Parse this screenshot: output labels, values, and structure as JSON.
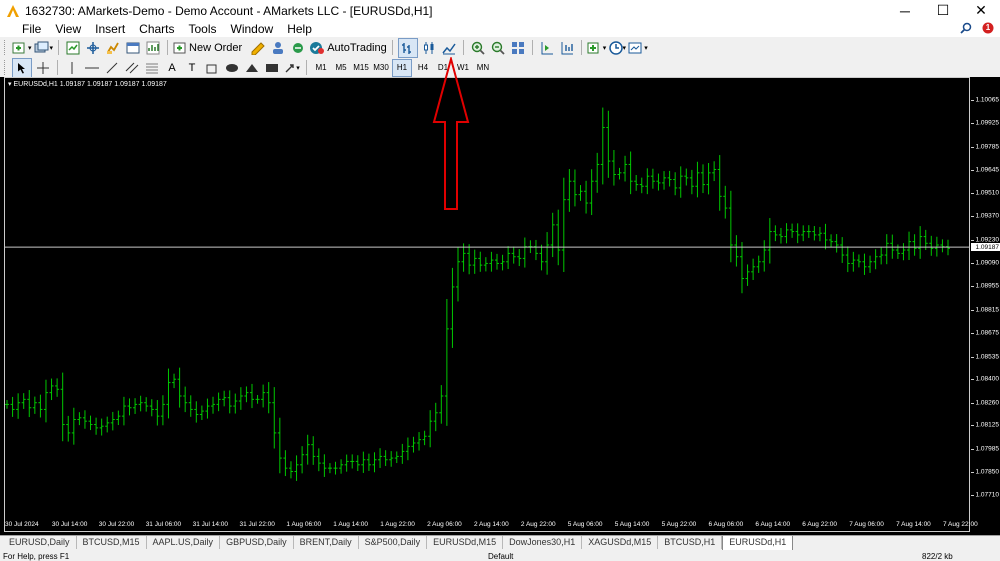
{
  "window": {
    "title": "1632730: AMarkets-Demo - Demo Account - AMarkets LLC - [EURUSDd,H1]",
    "controls": {
      "minimize": "─",
      "maximize": "☐",
      "close": "✕"
    }
  },
  "menu": {
    "items": [
      {
        "label": "File"
      },
      {
        "label": "View"
      },
      {
        "label": "Insert"
      },
      {
        "label": "Charts"
      },
      {
        "label": "Tools"
      },
      {
        "label": "Window"
      },
      {
        "label": "Help"
      }
    ],
    "notification_count": "1"
  },
  "toolbar": {
    "new_order_label": "New Order",
    "autotrading_label": "AutoTrading",
    "timeframes": [
      "M1",
      "M5",
      "M15",
      "M30",
      "H1",
      "H4",
      "D1",
      "W1",
      "MN"
    ],
    "active_timeframe": "H1"
  },
  "chart": {
    "info_line": "EURUSDd,H1  1.09187 1.09187 1.09187 1.09187",
    "current_price": "1.09187",
    "background": "#000000",
    "bar_color": "#00c800",
    "annotation_arrow_color": "#e00000"
  },
  "chart_data": {
    "type": "ohlc",
    "symbol": "EURUSDd",
    "timeframe": "H1",
    "ylim": [
      1.0771,
      1.1007
    ],
    "y_ticks": [
      "1.10065",
      "1.09925",
      "1.09785",
      "1.09645",
      "1.09510",
      "1.09370",
      "1.09230",
      "1.09090",
      "1.08955",
      "1.08815",
      "1.08675",
      "1.08535",
      "1.08400",
      "1.08260",
      "1.08125",
      "1.07985",
      "1.07850",
      "1.07710"
    ],
    "x_ticks": [
      "30 Jul 2024",
      "30 Jul 14:00",
      "30 Jul 22:00",
      "31 Jul 06:00",
      "31 Jul 14:00",
      "31 Jul 22:00",
      "1 Aug 06:00",
      "1 Aug 14:00",
      "1 Aug 22:00",
      "2 Aug 06:00",
      "2 Aug 14:00",
      "2 Aug 22:00",
      "5 Aug 06:00",
      "5 Aug 14:00",
      "5 Aug 22:00",
      "6 Aug 06:00",
      "6 Aug 14:00",
      "6 Aug 22:00",
      "7 Aug 06:00",
      "7 Aug 14:00",
      "7 Aug 22:00"
    ],
    "current_price": 1.09187,
    "closes": [
      1.0825,
      1.0822,
      1.0826,
      1.0828,
      1.0823,
      1.0826,
      1.0822,
      1.0832,
      1.0836,
      1.0834,
      1.0813,
      1.0808,
      1.0816,
      1.0817,
      1.0815,
      1.0813,
      1.0811,
      1.0812,
      1.0814,
      1.0816,
      1.0818,
      1.0824,
      1.0823,
      1.0825,
      1.0826,
      1.0824,
      1.0822,
      1.0818,
      1.0825,
      1.0838,
      1.084,
      1.083,
      1.0826,
      1.0822,
      1.0819,
      1.0821,
      1.0824,
      1.0825,
      1.0828,
      1.0829,
      1.0824,
      1.0827,
      1.083,
      1.0832,
      1.0828,
      1.0828,
      1.0832,
      1.0826,
      1.0808,
      1.0793,
      1.0787,
      1.0785,
      1.0789,
      1.0795,
      1.0801,
      1.0794,
      1.079,
      1.0787,
      1.0787,
      1.0787,
      1.0789,
      1.0791,
      1.0791,
      1.0789,
      1.0792,
      1.0789,
      1.0792,
      1.0794,
      1.0792,
      1.0793,
      1.0794,
      1.0797,
      1.08,
      1.0802,
      1.0804,
      1.0806,
      1.0815,
      1.082,
      1.083,
      1.087,
      1.0895,
      1.091,
      1.0915,
      1.0908,
      1.0912,
      1.0908,
      1.0909,
      1.0911,
      1.0909,
      1.091,
      1.0915,
      1.0913,
      1.0912,
      1.0919,
      1.0919,
      1.0915,
      1.091,
      1.092,
      1.0932,
      1.0917,
      1.0947,
      1.0958,
      1.095,
      1.0952,
      1.0945,
      1.0958,
      1.0968,
      1.099,
      1.097,
      1.0962,
      1.0963,
      1.0968,
      1.0958,
      1.0956,
      1.0955,
      1.0961,
      1.0958,
      1.0957,
      1.096,
      1.0959,
      1.0954,
      1.0961,
      1.096,
      1.0955,
      1.0963,
      1.0956,
      1.0963,
      1.0965,
      1.0949,
      1.0942,
      1.092,
      1.0913,
      1.09,
      1.0904,
      1.0907,
      1.091,
      1.0917,
      1.0928,
      1.0926,
      1.0925,
      1.0929,
      1.0928,
      1.0926,
      1.0928,
      1.0928,
      1.0926,
      1.0927,
      1.0923,
      1.0922,
      1.092,
      1.0914,
      1.0909,
      1.0911,
      1.091,
      1.0907,
      1.091,
      1.0913,
      1.0914,
      1.0921,
      1.0917,
      1.0915,
      1.0917,
      1.0922,
      1.0918,
      1.0925,
      1.0921,
      1.0918,
      1.092,
      1.0919,
      1.0918
    ]
  },
  "tabs": [
    {
      "label": "EURUSD,Daily"
    },
    {
      "label": "BTCUSD,M15"
    },
    {
      "label": "AAPL.US,Daily"
    },
    {
      "label": "GBPUSD,Daily"
    },
    {
      "label": "BRENT,Daily"
    },
    {
      "label": "S&P500,Daily"
    },
    {
      "label": "EURUSDd,M15"
    },
    {
      "label": "DowJones30,H1"
    },
    {
      "label": "XAGUSDd,M15"
    },
    {
      "label": "BTCUSD,H1"
    },
    {
      "label": "EURUSDd,H1"
    }
  ],
  "active_tab": "EURUSDd,H1",
  "status": {
    "help": "For Help, press F1",
    "profile": "Default",
    "traffic": "822/2 kb"
  }
}
